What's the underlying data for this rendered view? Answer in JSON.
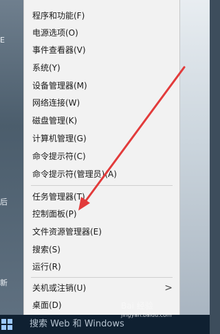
{
  "menu": {
    "items": [
      {
        "label": "程序和功能(F)"
      },
      {
        "label": "电源选项(O)"
      },
      {
        "label": "事件查看器(V)"
      },
      {
        "label": "系统(Y)"
      },
      {
        "label": "设备管理器(M)"
      },
      {
        "label": "网络连接(W)"
      },
      {
        "label": "磁盘管理(K)"
      },
      {
        "label": "计算机管理(G)"
      },
      {
        "label": "命令提示符(C)"
      },
      {
        "label": "命令提示符(管理员)(A)"
      },
      {
        "label": "任务管理器(T)"
      },
      {
        "label": "控制面板(P)"
      },
      {
        "label": "文件资源管理器(E)"
      },
      {
        "label": "搜索(S)"
      },
      {
        "label": "运行(R)"
      },
      {
        "label": "关机或注销(U)"
      },
      {
        "label": "桌面(D)"
      }
    ],
    "submenu_chevron": ">"
  },
  "taskbar": {
    "search_label": "搜索 Web 和 Windows"
  },
  "watermark": {
    "top_text": "Bai 经验",
    "bottom_text": "jingyan.baidu.com"
  },
  "left_edge_texts": [
    "E",
    "后",
    "新"
  ],
  "colors": {
    "menu_bg": "#f2f2f2",
    "arrow": "#e23b3b",
    "taskbar": "#0f2031"
  }
}
